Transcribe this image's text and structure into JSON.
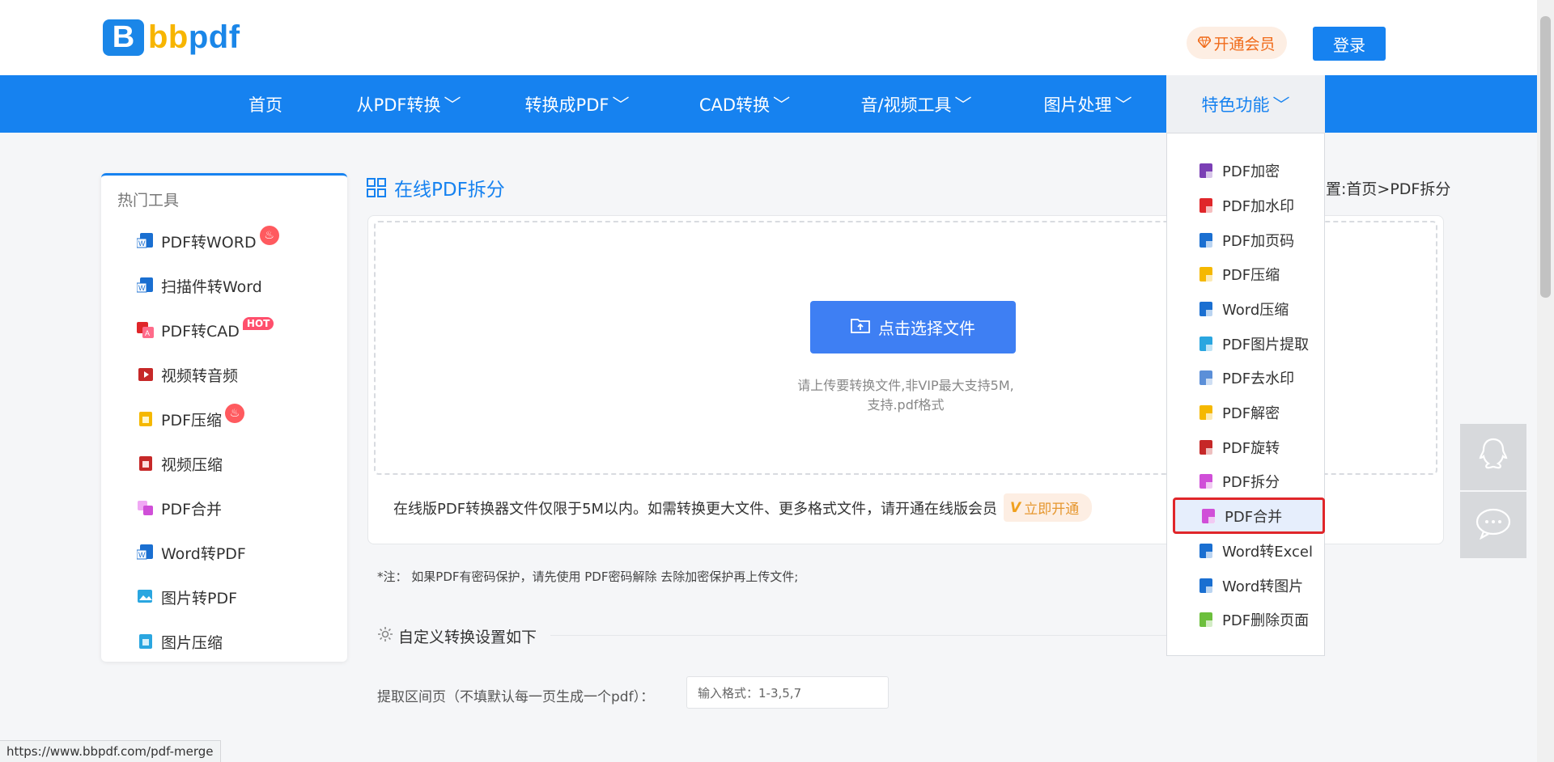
{
  "brand": {
    "logo_letter": "B",
    "logo_part1": "bb",
    "logo_part2": "pdf"
  },
  "header": {
    "vip_label": "开通会员",
    "login_label": "登录"
  },
  "nav": {
    "items": [
      {
        "label": "首页",
        "has_chevron": false
      },
      {
        "label": "从PDF转换",
        "has_chevron": true
      },
      {
        "label": "转换成PDF",
        "has_chevron": true
      },
      {
        "label": "CAD转换",
        "has_chevron": true
      },
      {
        "label": "音/视频工具",
        "has_chevron": true
      },
      {
        "label": "图片处理",
        "has_chevron": true
      },
      {
        "label": "特色功能",
        "has_chevron": true,
        "active": true
      }
    ],
    "chevron": "﹀"
  },
  "sidebar": {
    "title": "热门工具",
    "items": [
      {
        "label": "PDF转WORD",
        "badge": "fire",
        "icon": "word-icon"
      },
      {
        "label": "扫描件转Word",
        "badge": "",
        "icon": "word-icon"
      },
      {
        "label": "PDF转CAD",
        "badge": "HOT",
        "icon": "cad-icon"
      },
      {
        "label": "视频转音频",
        "badge": "",
        "icon": "video-icon"
      },
      {
        "label": "PDF压缩",
        "badge": "fire",
        "icon": "compress-icon"
      },
      {
        "label": "视频压缩",
        "badge": "",
        "icon": "video-icon"
      },
      {
        "label": "PDF合并",
        "badge": "",
        "icon": "merge-icon"
      },
      {
        "label": "Word转PDF",
        "badge": "",
        "icon": "word-icon"
      },
      {
        "label": "图片转PDF",
        "badge": "",
        "icon": "image-icon"
      },
      {
        "label": "图片压缩",
        "badge": "",
        "icon": "image-icon"
      }
    ],
    "hot_badge_text": "HOT"
  },
  "main": {
    "title": "在线PDF拆分",
    "breadcrumb": "置:首页>PDF拆分",
    "choose_file_label": "点击选择文件",
    "upload_hint_line1": "请上传要转换文件,非VIP最大支持5M,",
    "upload_hint_line2": "支持.pdf格式",
    "limit_note": "在线版PDF转换器文件仅限于5M以内。如需转换更大文件、更多格式文件，请开通在线版会员",
    "open_vip_label": "立即开通",
    "footnote": "*注： 如果PDF有密码保护，请先使用 PDF密码解除 去除加密保护再上传文件;",
    "settings_title": "自定义转换设置如下",
    "range_label": "提取区间页（不填默认每一页生成一个pdf）：",
    "range_placeholder": "输入格式：1-3,5,7"
  },
  "dropdown": {
    "items": [
      {
        "label": "PDF加密",
        "color": "#7b3fb5"
      },
      {
        "label": "PDF加水印",
        "color": "#e0262a"
      },
      {
        "label": "PDF加页码",
        "color": "#1a6fd1"
      },
      {
        "label": "PDF压缩",
        "color": "#f5b800"
      },
      {
        "label": "Word压缩",
        "color": "#1a6fd1"
      },
      {
        "label": "PDF图片提取",
        "color": "#2aa6e0"
      },
      {
        "label": "PDF去水印",
        "color": "#5b8fd8"
      },
      {
        "label": "PDF解密",
        "color": "#f5b800"
      },
      {
        "label": "PDF旋转",
        "color": "#c62828"
      },
      {
        "label": "PDF拆分",
        "color": "#d04fd8"
      },
      {
        "label": "PDF合并",
        "color": "#d04fd8",
        "highlight": true
      },
      {
        "label": "Word转Excel",
        "color": "#1a6fd1"
      },
      {
        "label": "Word转图片",
        "color": "#1a6fd1"
      },
      {
        "label": "PDF删除页面",
        "color": "#6cbf3c"
      }
    ]
  },
  "floaters": {
    "qq_icon": "qq-icon",
    "chat_icon": "chat-icon"
  },
  "statusbar": {
    "url": "https://www.bbpdf.com/pdf-merge"
  },
  "colors": {
    "primary": "#1682f0",
    "button": "#3e7ff3",
    "highlight_border": "#e0262a"
  }
}
